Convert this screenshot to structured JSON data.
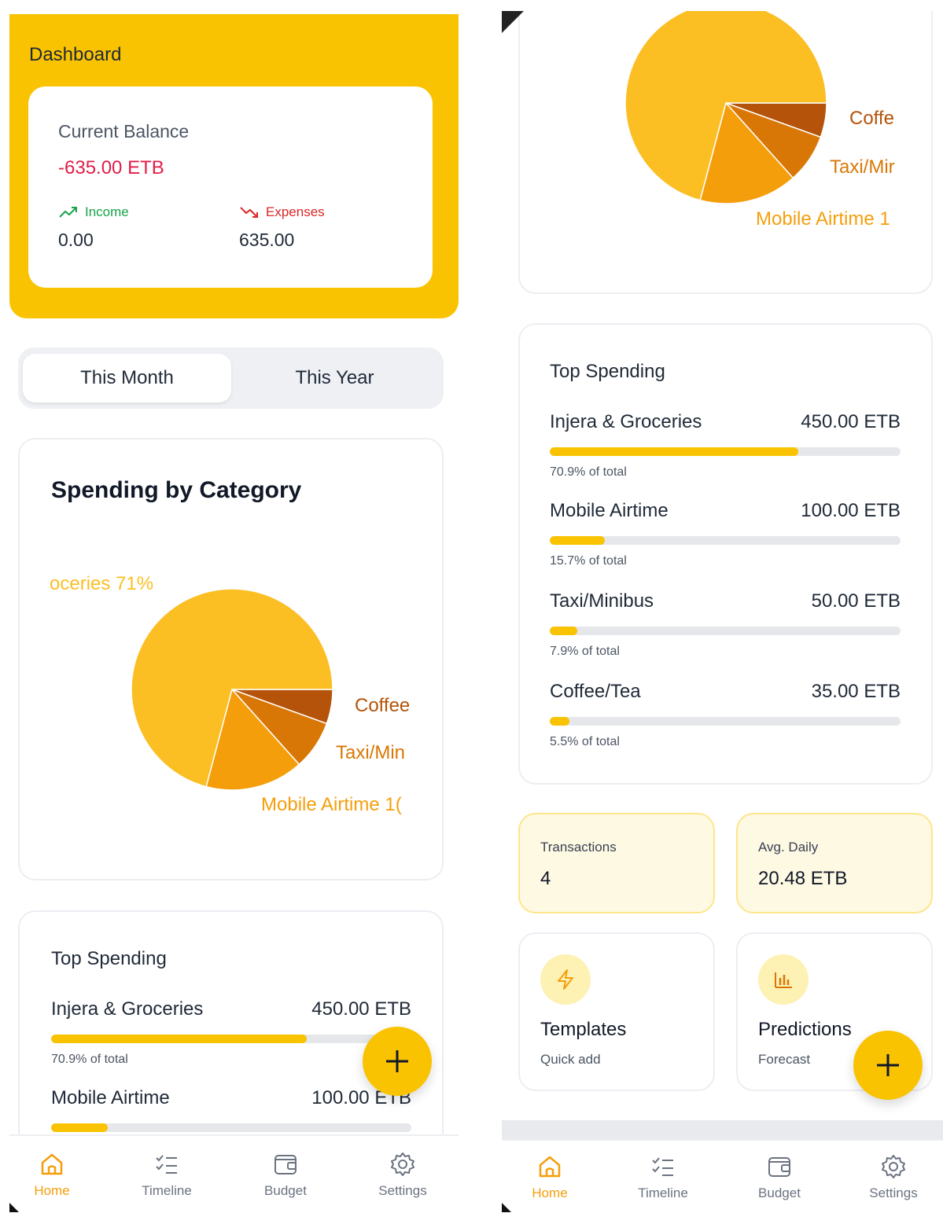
{
  "header": {
    "title": "Dashboard"
  },
  "balance": {
    "label": "Current Balance",
    "value": "-635.00 ETB",
    "income": {
      "label": "Income",
      "value": "0.00"
    },
    "expenses": {
      "label": "Expenses",
      "value": "635.00"
    }
  },
  "period": {
    "options": [
      "This Month",
      "This Year"
    ],
    "selected": "This Month"
  },
  "spending_chart": {
    "title": "Spending by Category",
    "labels_left": {
      "groceries": "oceries 71%",
      "coffee": "Coffee",
      "taxi": "Taxi/Min",
      "airtime": "Mobile Airtime 1("
    },
    "labels_right": {
      "coffee": "Coffe",
      "taxi": "Taxi/Mir",
      "airtime": "Mobile Airtime 1"
    }
  },
  "chart_data": {
    "type": "pie",
    "categories": [
      "Injera & Groceries",
      "Mobile Airtime",
      "Taxi/Minibus",
      "Coffee/Tea"
    ],
    "values": [
      450,
      100,
      50,
      35
    ],
    "percentages": [
      70.9,
      15.7,
      7.9,
      5.5
    ],
    "colors": [
      "#fbbf24",
      "#f59e0b",
      "#d97706",
      "#b45309"
    ]
  },
  "top_spending": {
    "title": "Top Spending",
    "items": [
      {
        "name": "Injera & Groceries",
        "amount": "450.00 ETB",
        "pct_text": "70.9% of total",
        "pct": 70.9
      },
      {
        "name": "Mobile Airtime",
        "amount": "100.00 ETB",
        "pct_text": "15.7% of total",
        "pct": 15.7
      },
      {
        "name": "Taxi/Minibus",
        "amount": "50.00 ETB",
        "pct_text": "7.9% of total",
        "pct": 7.9
      },
      {
        "name": "Coffee/Tea",
        "amount": "35.00 ETB",
        "pct_text": "5.5% of total",
        "pct": 5.5
      }
    ],
    "left_partial_item2_amount": "100.00 ETB"
  },
  "stats": {
    "transactions": {
      "label": "Transactions",
      "value": "4"
    },
    "avg_daily": {
      "label": "Avg. Daily",
      "value": "20.48 ETB"
    }
  },
  "actions": {
    "templates": {
      "title": "Templates",
      "subtitle": "Quick add",
      "icon": "lightning-icon"
    },
    "predictions": {
      "title": "Predictions",
      "subtitle": "Forecast",
      "icon": "bar-chart-icon"
    }
  },
  "nav": {
    "items": [
      {
        "label": "Home",
        "icon": "home-icon",
        "active": true
      },
      {
        "label": "Timeline",
        "icon": "checklist-icon",
        "active": false
      },
      {
        "label": "Budget",
        "icon": "wallet-icon",
        "active": false
      },
      {
        "label": "Settings",
        "icon": "gear-icon",
        "active": false
      }
    ]
  },
  "colors": {
    "accent": "#f9c301",
    "negative": "#e11d48",
    "income": "#16a34a",
    "expense": "#dc2626",
    "nav_active": "#f59e0b"
  }
}
